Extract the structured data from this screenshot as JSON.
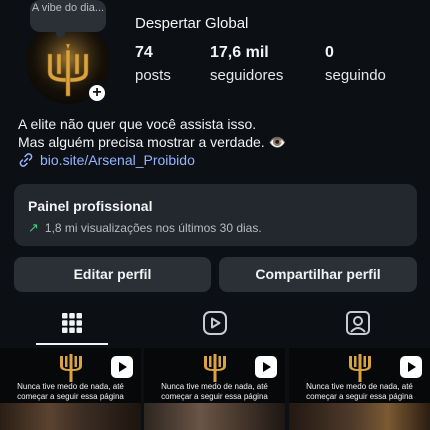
{
  "profile": {
    "note": "A vibe do dia...",
    "name": "Despertar Global",
    "stats": [
      {
        "value": "74",
        "label": "posts"
      },
      {
        "value": "17,6 mil",
        "label": "seguidores"
      },
      {
        "value": "0",
        "label": "seguindo"
      }
    ],
    "bio_line_1": "A elite não quer que você assista isso.",
    "bio_line_2": "Mas alguém precisa mostrar a verdade. 👁️",
    "bio_link": "bio.site/Arsenal_Proibido",
    "add_icon": "plus-icon"
  },
  "pro_panel": {
    "title": "Painel profissional",
    "subtitle": "1,8 mi visualizações nos últimos 30 dias.",
    "icon": "trending-up-icon"
  },
  "actions": {
    "edit_label": "Editar perfil",
    "share_label": "Compartilhar perfil"
  },
  "tabs": [
    {
      "icon": "grid-icon",
      "active": true
    },
    {
      "icon": "reels-icon",
      "active": false
    },
    {
      "icon": "tagged-icon",
      "active": false
    }
  ],
  "posts": [
    {
      "caption_1": "Nunca tive medo de nada, até",
      "caption_2": "começar a seguir essa página",
      "icon": "reel-icon"
    },
    {
      "caption_1": "Nunca tive medo de nada, até",
      "caption_2": "começar a seguir essa página",
      "icon": "reel-icon"
    },
    {
      "caption_1": "Nunca tive medo de nada, até",
      "caption_2": "começar a seguir essa página",
      "icon": "reel-icon"
    }
  ],
  "colors": {
    "background": "#0c0f14",
    "card": "#23272e",
    "button": "#2b2f36",
    "link": "#93b4ff",
    "trend": "#3fcf7a",
    "gold": "#d9a440"
  }
}
